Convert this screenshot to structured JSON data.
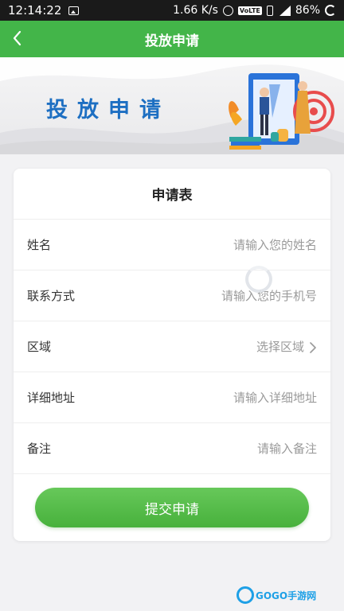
{
  "statusbar": {
    "time": "12:14:22",
    "speed": "1.66 K/s",
    "volte": "VoLTE",
    "battery": "86%"
  },
  "navbar": {
    "title": "投放申请",
    "back_icon": "chevron-left-icon"
  },
  "banner": {
    "headline": "投放申请"
  },
  "form": {
    "title": "申请表",
    "fields": [
      {
        "label": "姓名",
        "placeholder": "请输入您的姓名",
        "value": ""
      },
      {
        "label": "联系方式",
        "placeholder": "请输入您的手机号",
        "value": ""
      },
      {
        "label": "区域",
        "placeholder": "选择区域",
        "value": ""
      },
      {
        "label": "详细地址",
        "placeholder": "请输入详细地址",
        "value": ""
      },
      {
        "label": "备注",
        "placeholder": "请输入备注",
        "value": ""
      }
    ],
    "submit_label": "提交申请"
  },
  "watermark": {
    "text": "GOGO手游网"
  },
  "colors": {
    "accent": "#43b549",
    "headline": "#1d6fc2"
  }
}
